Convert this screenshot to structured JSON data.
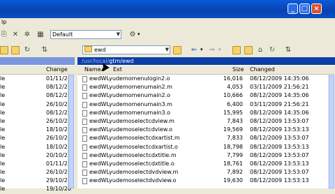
{
  "menu": {
    "partial_label": "lp"
  },
  "toolbar": {
    "profile_combo": "Default",
    "left_path_combo": "",
    "right_path_combo": "ewd"
  },
  "left_panel": {
    "header_change": "Change",
    "rows": [
      {
        "kind": "le",
        "date": "01/11/20"
      },
      {
        "kind": "le",
        "date": "08/12/20"
      },
      {
        "kind": "le",
        "date": "08/12/20"
      },
      {
        "kind": "le",
        "date": "26/10/20"
      },
      {
        "kind": "le",
        "date": "08/12/20"
      },
      {
        "kind": "le",
        "date": "26/10/20"
      },
      {
        "kind": "le",
        "date": "18/10/20"
      },
      {
        "kind": "le",
        "date": "26/10/20"
      },
      {
        "kind": "le",
        "date": "18/10/20"
      },
      {
        "kind": "le",
        "date": "20/10/20"
      },
      {
        "kind": "le",
        "date": "01/11/20"
      },
      {
        "kind": "le",
        "date": "26/10/20"
      },
      {
        "kind": "le",
        "date": "29/10/20"
      },
      {
        "kind": "le",
        "date": "19/10/20"
      }
    ]
  },
  "right_panel": {
    "path_prefix": "/usr/local/",
    "path_current": "gtm/ewd",
    "header": {
      "name": "Name",
      "ext": "Ext",
      "size": "Size",
      "changed": "Changed"
    },
    "rows": [
      {
        "name": "ewdWLyudemomenulogin2.o",
        "size": "16,016",
        "changed": "08/12/2009 14:35:06"
      },
      {
        "name": "ewdWLyudemomenumain2.m",
        "size": "4,053",
        "changed": "03/11/2009 21:56:21"
      },
      {
        "name": "ewdWLyudemomenumain2.o",
        "size": "10,666",
        "changed": "08/12/2009 14:35:06"
      },
      {
        "name": "ewdWLyudemomenumain3.m",
        "size": "6,400",
        "changed": "03/11/2009 21:56:21"
      },
      {
        "name": "ewdWLyudemomenumain3.o",
        "size": "15,995",
        "changed": "08/12/2009 14:35:06"
      },
      {
        "name": "ewdWLyudemoselectcdview.m",
        "size": "7,843",
        "changed": "08/12/2009 13:53:07"
      },
      {
        "name": "ewdWLyudemoselectcdview.o",
        "size": "19,569",
        "changed": "08/12/2009 13:53:13"
      },
      {
        "name": "ewdWLyudemoselectcdxartist.m",
        "size": "7,833",
        "changed": "08/12/2009 13:53:07"
      },
      {
        "name": "ewdWLyudemoselectcdxartist.o",
        "size": "18,798",
        "changed": "08/12/2009 13:53:13"
      },
      {
        "name": "ewdWLyudemoselectcdxtitle.m",
        "size": "7,799",
        "changed": "08/12/2009 13:53:07"
      },
      {
        "name": "ewdWLyudemoselectcdxtitle.o",
        "size": "18,761",
        "changed": "08/12/2009 13:53:13"
      },
      {
        "name": "ewdWLyudemoselectdvdview.m",
        "size": "7,892",
        "changed": "08/12/2009 13:53:07"
      },
      {
        "name": "ewdWLyudemoselectdvdview.o",
        "size": "19,630",
        "changed": "08/12/2009 13:53:13"
      }
    ]
  }
}
